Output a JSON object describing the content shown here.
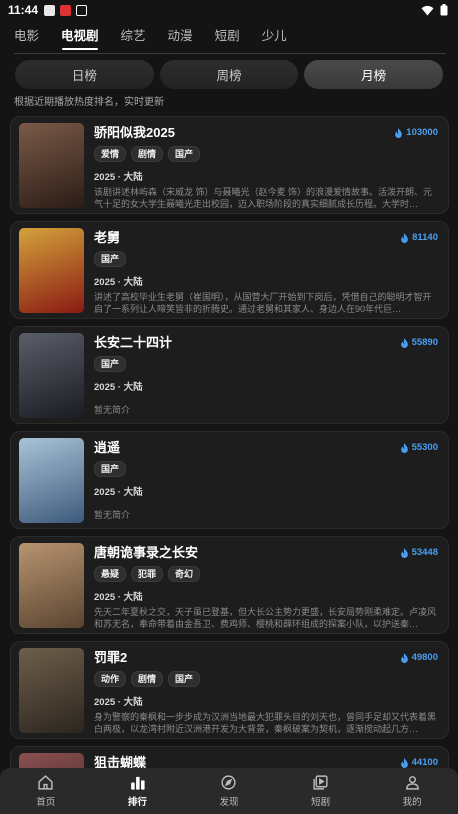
{
  "status": {
    "time": "11:44"
  },
  "category_tabs": [
    {
      "label": "电影"
    },
    {
      "label": "电视剧"
    },
    {
      "label": "综艺"
    },
    {
      "label": "动漫"
    },
    {
      "label": "短剧"
    },
    {
      "label": "少儿"
    }
  ],
  "range_tabs": [
    {
      "label": "日榜"
    },
    {
      "label": "周榜"
    },
    {
      "label": "月榜"
    }
  ],
  "subtitle": "根据近期播放热度排名，实时更新",
  "shows": [
    {
      "title": "骄阳似我2025",
      "heat": "103000",
      "tags": [
        "爱情",
        "剧情",
        "国产"
      ],
      "meta": "2025 · 大陆",
      "desc": "该剧讲述林屿森（宋威龙 饰）与聂曦光（赵今麦 饰）的浪漫爱情故事。活泼开朗、元气十足的女大学生聂曦光走出校园，迈入职场阶段的真实细腻成长历程。大学时…",
      "colors": [
        "#2b1c16",
        "#7a5a48"
      ]
    },
    {
      "title": "老舅",
      "heat": "81140",
      "tags": [
        "国产"
      ],
      "meta": "2025 · 大陆",
      "desc": "讲述了高校毕业生老舅（崔国明），从国营大厂开始到下岗后，凭借自己的聪明才智开启了一系列让人啼笑皆非的折腾史。通过老舅和其家人、身边人在90年代巨…",
      "colors": [
        "#8a1a14",
        "#d4a23a"
      ]
    },
    {
      "title": "长安二十四计",
      "heat": "55890",
      "tags": [
        "国产"
      ],
      "meta": "2025 · 大陆",
      "desc": "暂无简介",
      "colors": [
        "#1a1c22",
        "#5a5e68"
      ]
    },
    {
      "title": "逍遥",
      "heat": "55300",
      "tags": [
        "国产"
      ],
      "meta": "2025 · 大陆",
      "desc": "暂无简介",
      "colors": [
        "#3e5a7c",
        "#a8c4d8"
      ]
    },
    {
      "title": "唐朝诡事录之长安",
      "heat": "53448",
      "tags": [
        "悬疑",
        "犯罪",
        "奇幻"
      ],
      "meta": "2025 · 大陆",
      "desc": "先天二年夏秋之交，天子虽已登基，但大长公主势力更盛，长安局势刚柔难定。卢凌风和苏无名，奉命带着由金吾卫、费鸡师、樱桃和薛环组成的探案小队，以护送秦…",
      "colors": [
        "#5a4430",
        "#b89470"
      ]
    },
    {
      "title": "罚罪2",
      "heat": "49800",
      "tags": [
        "动作",
        "剧情",
        "国产"
      ],
      "meta": "2025 · 大陆",
      "desc": "身为警察的秦枫和一步步成为汉洲当地最大犯罪头目的刘天也，曾同手足却又代表着黑白两极，以龙湾村附近汉洲港开发为大背景，秦枫破案为契机，逐渐搅动起几方…",
      "colors": [
        "#2c2620",
        "#6e5e4a"
      ]
    },
    {
      "title": "狙击蝴蝶",
      "heat": "44100",
      "tags": [],
      "meta": "",
      "desc": "",
      "colors": [
        "#3a2020",
        "#8a5050"
      ]
    }
  ],
  "bottom_nav": [
    {
      "label": "首页",
      "icon": "home-icon"
    },
    {
      "label": "排行",
      "icon": "ranking-icon"
    },
    {
      "label": "发现",
      "icon": "compass-icon"
    },
    {
      "label": "短剧",
      "icon": "play-square-icon"
    },
    {
      "label": "我的",
      "icon": "user-icon"
    }
  ],
  "accent": "#4a9ef0"
}
